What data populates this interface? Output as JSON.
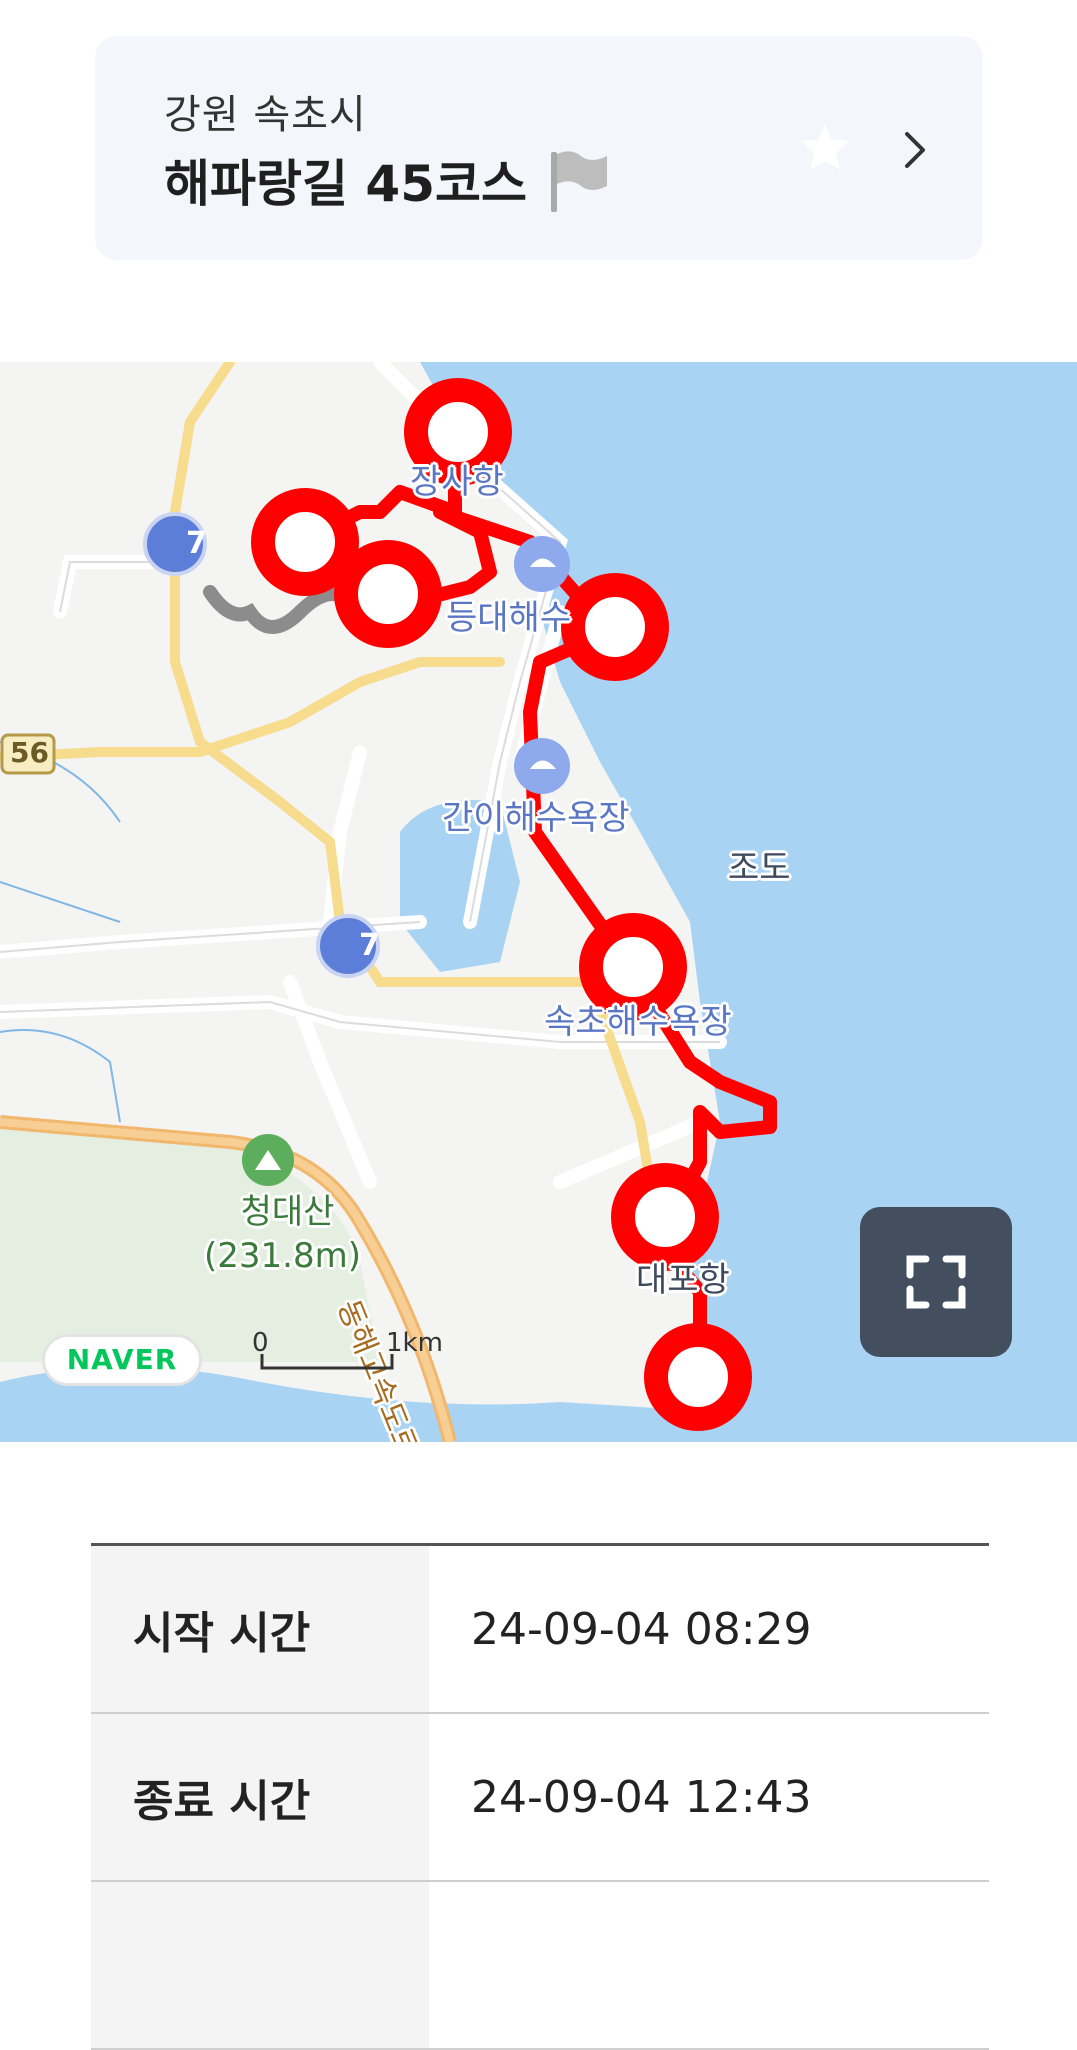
{
  "course": {
    "region": "강원 속초시",
    "name": "해파랑길 45코스"
  },
  "map": {
    "labels": {
      "port_north": "장사항",
      "beach1": "등대해수",
      "beach2": "간이해수욕장",
      "island": "조도",
      "beach3": "속초해수욕장",
      "mountain": "청대산",
      "mountain_height": "(231.8m)",
      "port_south": "대포항",
      "highway": "동해고속도로삼척-속",
      "route7_a": "7",
      "route7_b": "7",
      "route56": "56"
    },
    "logo": "NAVER",
    "scale": {
      "start": "0",
      "end": "1km"
    },
    "colors": {
      "sea": "#a9d3f2",
      "route": "#ff0000",
      "land": "#f4f4f2"
    }
  },
  "records": [
    {
      "label": "시작 시간",
      "value": "24-09-04 08:29"
    },
    {
      "label": "종료 시간",
      "value": "24-09-04 12:43"
    }
  ]
}
